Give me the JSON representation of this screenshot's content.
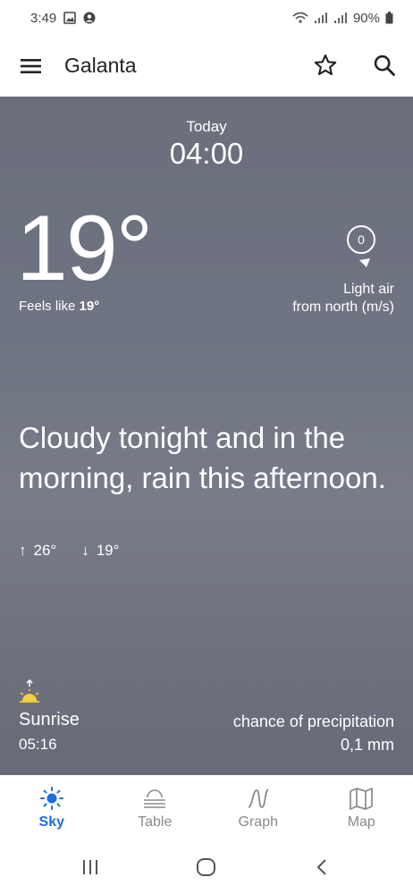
{
  "status_bar": {
    "time": "3:49",
    "battery": "90%"
  },
  "app_bar": {
    "title": "Galanta"
  },
  "forecast": {
    "date_label": "Today",
    "time": "04:00",
    "temperature": "19°",
    "feels_like_prefix": "Feels like ",
    "feels_like_value": "19°",
    "wind_speed": "0",
    "wind_line1": "Light air",
    "wind_line2": "from north (m/s)",
    "summary": "Cloudy tonight and in the morning, rain this afternoon.",
    "max_temp": "26°",
    "min_temp": "19°",
    "sunrise_label": "Sunrise",
    "sunrise_time": "05:16",
    "precip_label": "chance of precipitation",
    "precip_value": "0,1 mm"
  },
  "bottom_nav": {
    "items": [
      {
        "label": "Sky",
        "icon": "sun-icon",
        "active": true
      },
      {
        "label": "Table",
        "icon": "table-icon",
        "active": false
      },
      {
        "label": "Graph",
        "icon": "graph-icon",
        "active": false
      },
      {
        "label": "Map",
        "icon": "map-icon",
        "active": false
      }
    ]
  },
  "colors": {
    "accent": "#1e6fd9",
    "hero_bg": "#6f7482",
    "nav_inactive": "#8a8a8a"
  }
}
